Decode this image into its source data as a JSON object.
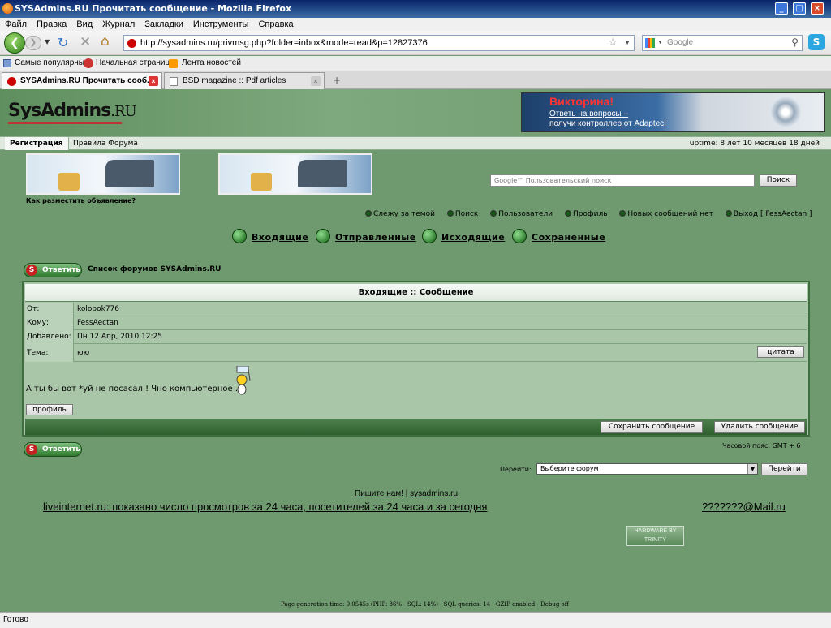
{
  "window": {
    "title": "SYSAdmins.RU Прочитать сообщение - Mozilla Firefox"
  },
  "menu": [
    "Файл",
    "Правка",
    "Вид",
    "Журнал",
    "Закладки",
    "Инструменты",
    "Справка"
  ],
  "navbar": {
    "url": "http://sysadmins.ru/privmsg.php?folder=inbox&mode=read&p=12827376",
    "search_placeholder": "Google"
  },
  "bookmarks": [
    "Самые популярные",
    "Начальная страница",
    "Лента новостей"
  ],
  "tabs": [
    {
      "label": "SYSAdmins.RU Прочитать сооб...",
      "active": true
    },
    {
      "label": "BSD magazine :: Pdf articles",
      "active": false
    }
  ],
  "site": {
    "logo_main": "SysAdmins",
    "logo_ru": ".RU",
    "ad_title": "Викторина!",
    "ad_line1": "Ответь на вопросы –",
    "ad_line2": "получи контроллер от Adaptec!",
    "nav_register": "Регистрация",
    "nav_rules": "Правила Форума",
    "uptime": "uptime: 8 лет 10 месяцев 18 дней",
    "howto": "Как разместить объявление?",
    "gsearch_placeholder": "Google™ Пользовательский поиск",
    "search_btn": "Поиск"
  },
  "userlinks": [
    "Слежу за темой",
    "Поиск",
    "Пользователи",
    "Профиль",
    "Новых сообщений нет",
    "Выход [ FessAectan ]"
  ],
  "folders": [
    "Входящие",
    "Отправленные",
    "Исходящие",
    "Сохраненные"
  ],
  "reply_label": "Ответить",
  "forum_list": "Список форумов SYSAdmins.RU",
  "message": {
    "header": "Входящие :: Сообщение",
    "from_label": "От:",
    "from": "kolobok776",
    "to_label": "Кому:",
    "to": "FessAectan",
    "date_label": "Добавлено:",
    "date": "Пн 12 Апр, 2010 12:25",
    "subject_label": "Тема:",
    "subject": "юю",
    "quote_btn": "цитата",
    "body": "А ты бы вот *уй не посасал ! Чно компьютерное .",
    "profile_btn": "профиль",
    "save_btn": "Сохранить сообщение",
    "delete_btn": "Удалить сообщение"
  },
  "timezone": "Часовой пояс: GMT + 6",
  "jump": {
    "label": "Перейти:",
    "selected": "Выберите форум",
    "go_btn": "Перейти"
  },
  "footer": {
    "write_us": "Пишите нам!",
    "sep": "|",
    "site_link": "sysadmins.ru",
    "liveinternet": "liveinternet.ru: показано число просмотров за 24 часа, посетителей за 24 часа и за сегодня",
    "mailru": "???????@Mail.ru",
    "badge_line1": "HARDWARE BY",
    "badge_line2": "TRINITY",
    "pgen": "Page generation time: 0.0545s (PHP: 86% - SQL: 14%) - SQL queries: 14 - GZIP enabled - Debug off"
  },
  "status": "Готово"
}
